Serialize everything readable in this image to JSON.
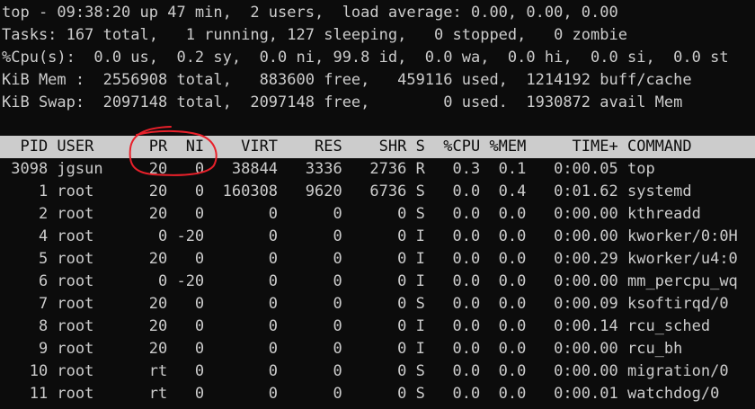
{
  "summary": {
    "uptime_line": "top - 09:38:20 up 47 min,  2 users,  load average: 0.00, 0.00, 0.00",
    "tasks_line": "Tasks: 167 total,   1 running, 127 sleeping,   0 stopped,   0 zombie",
    "cpu_line": "%Cpu(s):  0.0 us,  0.2 sy,  0.0 ni, 99.8 id,  0.0 wa,  0.0 hi,  0.0 si,  0.0 st",
    "mem_line": "KiB Mem :  2556908 total,   883600 free,   459116 used,  1214192 buff/cache",
    "swap_line": "KiB Swap:  2097148 total,  2097148 free,        0 used.  1930872 avail Mem"
  },
  "table": {
    "header": "  PID USER      PR  NI    VIRT    RES    SHR S  %CPU %MEM     TIME+ COMMAND",
    "rows": [
      " 3098 jgsun     20   0   38844   3336   2736 R   0.3  0.1   0:00.05 top",
      "    1 root      20   0  160308   9620   6736 S   0.0  0.4   0:01.62 systemd",
      "    2 root      20   0       0      0      0 S   0.0  0.0   0:00.00 kthreadd",
      "    4 root       0 -20       0      0      0 I   0.0  0.0   0:00.00 kworker/0:0H",
      "    5 root      20   0       0      0      0 I   0.0  0.0   0:00.29 kworker/u4:0",
      "    6 root       0 -20       0      0      0 I   0.0  0.0   0:00.00 mm_percpu_wq",
      "    7 root      20   0       0      0      0 S   0.0  0.0   0:00.09 ksoftirqd/0",
      "    8 root      20   0       0      0      0 I   0.0  0.0   0:00.14 rcu_sched",
      "    9 root      20   0       0      0      0 I   0.0  0.0   0:00.00 rcu_bh",
      "   10 root      rt   0       0      0      0 S   0.0  0.0   0:00.00 migration/0",
      "   11 root      rt   0       0      0      0 S   0.0  0.0   0:00.01 watchdog/0"
    ]
  },
  "colors": {
    "background": "#0c0c0c",
    "foreground": "#cccccc",
    "header_bg": "#cccccc",
    "annotation": "#e8202a"
  }
}
